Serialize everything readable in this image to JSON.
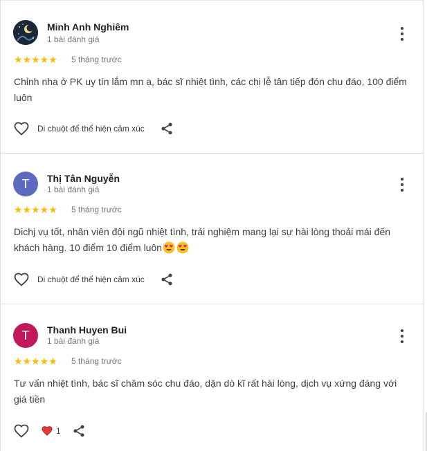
{
  "colors": {
    "star": "#fbbc04",
    "avatar_t1": "#5c6bc0",
    "avatar_t2": "#c2185b",
    "heart": "#e53935"
  },
  "reviews": [
    {
      "name": "Minh Anh Nghiêm",
      "sub": "1 bài đánh giá",
      "avatar": "avatar-photo",
      "rating": 5,
      "stars": "★★★★★",
      "time": "5 tháng trước",
      "text": "Chỉnh nha ở PK uy tín lắm mn ạ, bác sĩ nhiệt tình, các chị lễ tân tiếp đón chu đáo, 100 điểm luôn",
      "react_label": "Di chuột để thể hiện cảm xúc"
    },
    {
      "name": "Thị Tân Nguyễn",
      "sub": "1 bài đánh giá",
      "avatar_letter": "T",
      "rating": 5,
      "stars": "★★★★★",
      "time": "5 tháng trước",
      "text": "Dichj vụ tốt, nhân viên đội ngũ nhiệt tình, trải nghiệm mang lại sự hài lòng thoải mái đến khách hàng. 10 điểm 10 điểm luôn",
      "emojis": [
        "heart-eyes-emoji",
        "heart-eyes-emoji"
      ],
      "react_label": "Di chuột để thể hiện cảm xúc"
    },
    {
      "name": "Thanh Huyen Bui",
      "sub": "1 bài đánh giá",
      "avatar_letter": "T",
      "rating": 5,
      "stars": "★★★★★",
      "time": "5 tháng trước",
      "text": "Tư vấn nhiệt tình, bác sĩ chăm sóc chu đáo, dặn dò kĩ rất hài lòng, dịch vụ xứng đáng với giá tiền",
      "reaction_count": "1"
    }
  ]
}
